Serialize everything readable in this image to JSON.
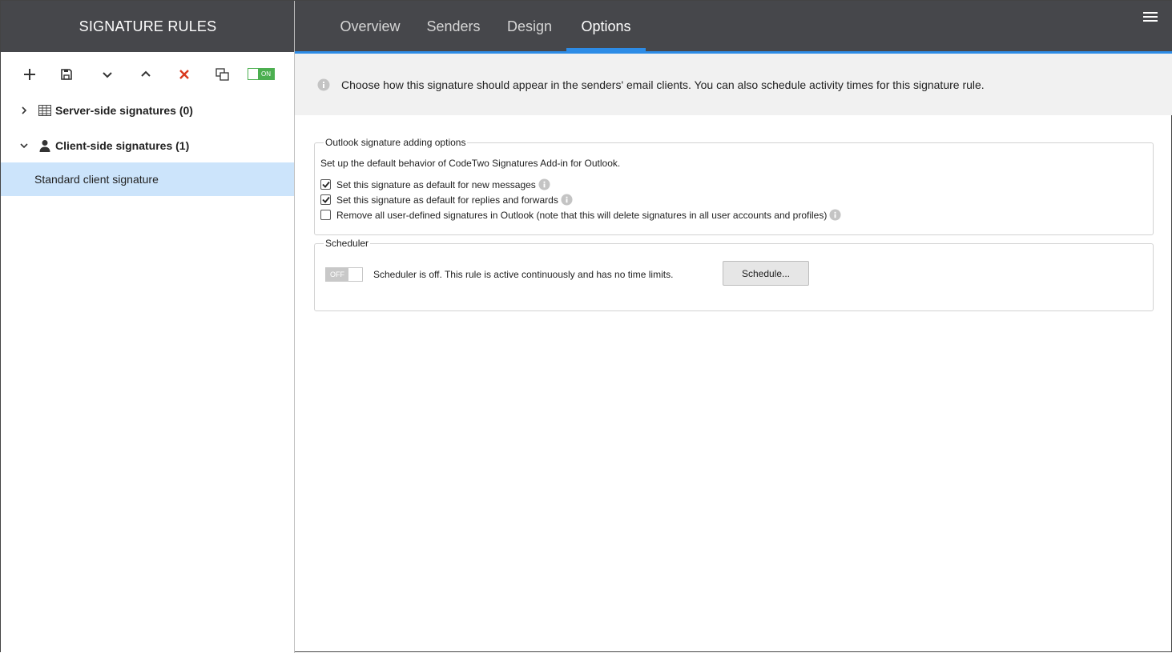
{
  "left": {
    "title": "SIGNATURE RULES",
    "toolbar": {
      "add_icon": "plus-icon",
      "save_icon": "save-icon",
      "move_down_icon": "chevron-down-icon",
      "move_up_icon": "chevron-up-icon",
      "delete_icon": "close-icon",
      "copy_icon": "copy-icon",
      "toggle_label": "ON",
      "toggle_color": "#4caf50",
      "delete_color": "#d9381e"
    },
    "tree": {
      "server": {
        "label": "Server-side signatures (0)",
        "icon": "server-icon",
        "expanded": false
      },
      "client": {
        "label": "Client-side signatures (1)",
        "icon": "user-icon",
        "expanded": true
      },
      "items": [
        {
          "label": "Standard client signature",
          "selected": true
        }
      ]
    }
  },
  "nav": {
    "tabs": [
      {
        "label": "Overview",
        "active": false
      },
      {
        "label": "Senders",
        "active": false
      },
      {
        "label": "Design",
        "active": false
      },
      {
        "label": "Options",
        "active": true
      }
    ],
    "menu_icon": "hamburger-icon",
    "accent": "#2d8ce6",
    "header_bg": "#46474b"
  },
  "info": {
    "icon": "info-icon",
    "message": "Choose how this signature should appear in the senders' email clients. You can also schedule activity times for this signature rule."
  },
  "outlook": {
    "legend": "Outlook signature adding options",
    "description": "Set up the default behavior of CodeTwo Signatures Add-in for Outlook.",
    "options": [
      {
        "label": "Set this signature as default for new messages",
        "checked": true
      },
      {
        "label": "Set this signature as default for replies and forwards",
        "checked": true
      },
      {
        "label": "Remove all user-defined signatures in Outlook (note that this will delete signatures in all user accounts and profiles)",
        "checked": false
      }
    ]
  },
  "scheduler": {
    "legend": "Scheduler",
    "toggle_label": "OFF",
    "status": "Scheduler is off. This rule is active continuously and has no time limits.",
    "button_label": "Schedule..."
  }
}
